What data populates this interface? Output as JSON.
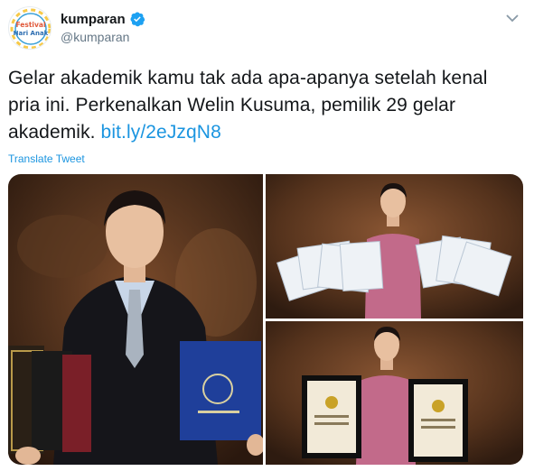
{
  "account": {
    "display_name": "kumparan",
    "handle": "@kumparan",
    "avatar_badge_lines": [
      "Festival",
      "Hari Anak"
    ],
    "verified": true
  },
  "tweet": {
    "text_part1": "Gelar akademik kamu tak ada apa-apanya setelah kenal pria ini. Perkenalkan Welin Kusuma, pemilik 29 gelar akademik. ",
    "link_text": "bit.ly/2eJzqN8",
    "translate_label": "Translate Tweet"
  },
  "media": {
    "photos": [
      {
        "name": "photo-main",
        "subject": "man-in-suit-holding-diploma-folders"
      },
      {
        "name": "photo-certificates",
        "subject": "man-holding-stacks-of-certificates"
      },
      {
        "name": "photo-record-frames",
        "subject": "man-holding-two-framed-records"
      }
    ]
  },
  "colors": {
    "link": "#1b95e0",
    "text": "#14171a",
    "secondary": "#657786",
    "verified": "#1da1f2"
  },
  "icons": [
    "verified-badge-icon",
    "chevron-down-icon"
  ]
}
